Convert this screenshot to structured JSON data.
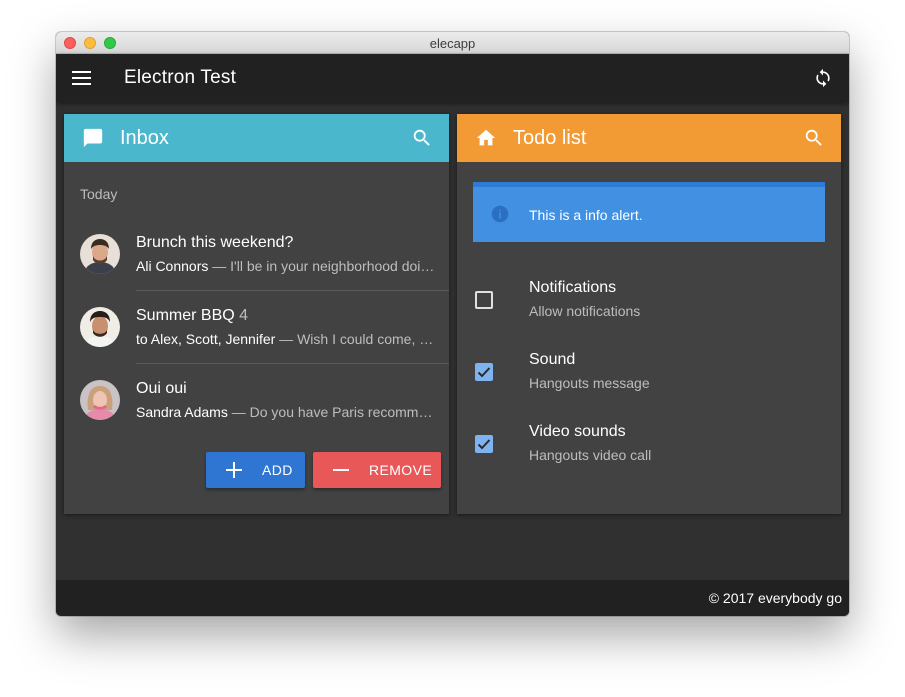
{
  "window": {
    "title": "elecapp"
  },
  "appbar": {
    "title": "Electron Test",
    "menu_icon": "menu-icon",
    "sync_icon": "sync-icon"
  },
  "inbox": {
    "title": "Inbox",
    "color": "#4bb7cd",
    "subheader": "Today",
    "messages": [
      {
        "title": "Brunch this weekend?",
        "count": "",
        "sender": "Ali Connors",
        "preview": " — I'll be in your neighborhood doing errands this weekend."
      },
      {
        "title": "Summer BBQ",
        "count": "4",
        "sender": "to Alex, Scott, Jennifer",
        "preview": " — Wish I could come, but I'm out of town this weekend."
      },
      {
        "title": "Oui oui",
        "count": "",
        "sender": "Sandra Adams",
        "preview": " — Do you have Paris recommendations?"
      }
    ],
    "add_label": "ADD",
    "remove_label": "REMOVE"
  },
  "todo": {
    "title": "Todo list",
    "color": "#f29a34",
    "alert": "This is a info alert.",
    "items": [
      {
        "title": "Notifications",
        "subtitle": "Allow notifications",
        "checked": false
      },
      {
        "title": "Sound",
        "subtitle": "Hangouts message",
        "checked": true
      },
      {
        "title": "Video sounds",
        "subtitle": "Hangouts video call",
        "checked": true
      }
    ]
  },
  "footer": {
    "text": "© 2017 everybody go"
  }
}
